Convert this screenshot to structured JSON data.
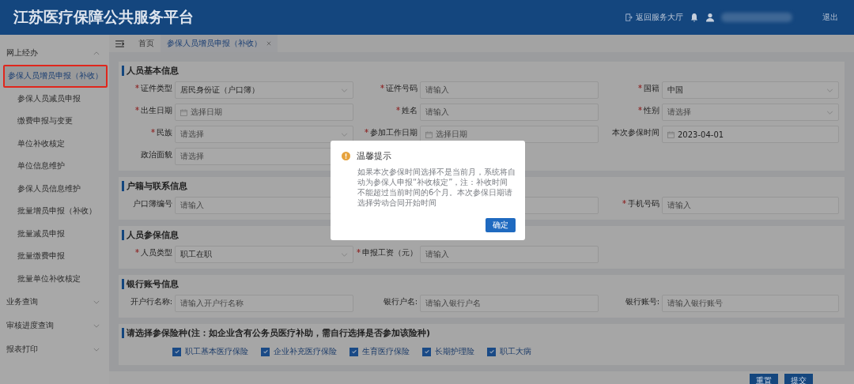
{
  "header": {
    "title": "江苏医疗保障公共服务平台",
    "back_link": "返回服务大厅",
    "logout": "退出"
  },
  "sidebar": {
    "groups": [
      {
        "label": "网上经办",
        "expanded": true,
        "items": [
          {
            "label": "参保人员增员申报（补收）",
            "selected": true,
            "highlighted": true
          },
          {
            "label": "参保人员减员申报",
            "selected": false,
            "highlighted": false
          },
          {
            "label": "缴费申报与变更",
            "selected": false,
            "highlighted": false
          },
          {
            "label": "单位补收核定",
            "selected": false,
            "highlighted": false
          },
          {
            "label": "单位信息维护",
            "selected": false,
            "highlighted": false
          },
          {
            "label": "参保人员信息维护",
            "selected": false,
            "highlighted": false
          },
          {
            "label": "批量增员申报（补收）",
            "selected": false,
            "highlighted": false
          },
          {
            "label": "批量减员申报",
            "selected": false,
            "highlighted": false
          },
          {
            "label": "批量缴费申报",
            "selected": false,
            "highlighted": false
          },
          {
            "label": "批量单位补收核定",
            "selected": false,
            "highlighted": false
          }
        ]
      },
      {
        "label": "业务查询",
        "expanded": false
      },
      {
        "label": "审核进度查询",
        "expanded": false
      },
      {
        "label": "报表打印",
        "expanded": false
      }
    ]
  },
  "tabs": [
    {
      "label": "首页",
      "selected": false,
      "closable": false
    },
    {
      "label": "参保人员增员申报（补收）",
      "selected": true,
      "closable": true
    }
  ],
  "sections": [
    {
      "title": "人员基本信息",
      "rows": [
        [
          {
            "label": "证件类型",
            "required": true,
            "kind": "select",
            "value": "居民身份证（户口簿）"
          },
          {
            "label": "证件号码",
            "required": true,
            "kind": "input",
            "placeholder": "请输入"
          },
          {
            "label": "国籍",
            "required": true,
            "kind": "select",
            "value": "中国"
          }
        ],
        [
          {
            "label": "出生日期",
            "required": true,
            "kind": "date",
            "placeholder": "选择日期"
          },
          {
            "label": "姓名",
            "required": true,
            "kind": "input",
            "placeholder": "请输入"
          },
          {
            "label": "性别",
            "required": true,
            "kind": "select",
            "placeholder": "请选择"
          }
        ],
        [
          {
            "label": "民族",
            "required": true,
            "kind": "select",
            "placeholder": "请选择"
          },
          {
            "label": "参加工作日期",
            "required": true,
            "kind": "date",
            "placeholder": "选择日期"
          },
          {
            "label": "本次参保时间",
            "required": false,
            "kind": "date",
            "value": "2023-04-01"
          }
        ],
        [
          {
            "label": "政治面貌",
            "required": false,
            "kind": "input",
            "placeholder": "请选择"
          }
        ]
      ]
    },
    {
      "title": "户籍与联系信息",
      "rows": [
        [
          {
            "label": "户口簿编号",
            "required": false,
            "kind": "input",
            "placeholder": "请输入"
          },
          {
            "required": false,
            "kind": "input"
          },
          {
            "label": "手机号码",
            "required": true,
            "kind": "input",
            "placeholder": "请输入"
          }
        ]
      ]
    },
    {
      "title": "人员参保信息",
      "rows": [
        [
          {
            "label": "人员类型",
            "required": true,
            "kind": "select",
            "value": "职工在职"
          },
          {
            "label": "申报工资（元）",
            "required": true,
            "kind": "input",
            "placeholder": "请输入"
          }
        ]
      ]
    },
    {
      "title": "银行账号信息",
      "rows": [
        [
          {
            "label": "开户行名称:",
            "required": false,
            "kind": "input",
            "placeholder": "请输入开户行名称"
          },
          {
            "label": "银行户名:",
            "required": false,
            "kind": "input",
            "placeholder": "请输入银行户名"
          },
          {
            "label": "银行账号:",
            "required": false,
            "kind": "input",
            "placeholder": "请输入银行账号"
          }
        ]
      ]
    },
    {
      "title": "请选择参保险种(注：如企业含有公务员医疗补助，需自行选择是否参加该险种)",
      "checkboxes": [
        {
          "label": "职工基本医疗保险",
          "checked": true
        },
        {
          "label": "企业补充医疗保险",
          "checked": true
        },
        {
          "label": "生育医疗保险",
          "checked": true
        },
        {
          "label": "长期护理险",
          "checked": true
        },
        {
          "label": "职工大病",
          "checked": true
        }
      ]
    }
  ],
  "footer_buttons": [
    "重置",
    "提交"
  ],
  "dialog": {
    "title": "温馨提示",
    "message": "如果本次参保时间选择不是当前月，系统将自动为参保人申报“补收核定”，注：补收时间不能超过当前时间的6个月。本次参保日期请选择劳动合同开始时间",
    "button": "确定"
  }
}
